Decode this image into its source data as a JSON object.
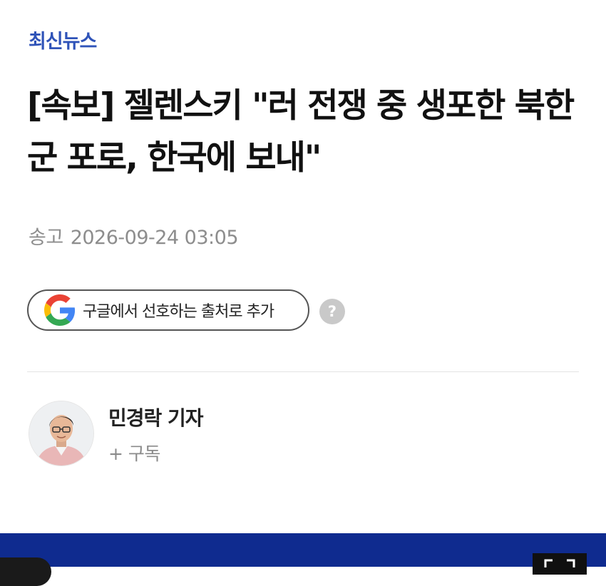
{
  "article": {
    "category": "최신뉴스",
    "headline": "[속보] 젤렌스키 \"러 전쟁 중 생포한 북한군 포로, 한국에 보내\"",
    "published_label": "송고",
    "published_datetime": "2026-09-24 03:05"
  },
  "google_button": {
    "label": "구글에서 선호하는 출처로 추가",
    "icon": "google-logo-icon"
  },
  "help": {
    "symbol": "?",
    "icon": "help-icon"
  },
  "author": {
    "name": "민경락 기자",
    "subscribe_label": "+ 구독",
    "avatar_icon": "reporter-avatar"
  },
  "colors": {
    "category": "#2f53b8",
    "bottom_bar": "#0f2b8f",
    "meta_text": "#8d8d8d",
    "google_blue": "#4285F4",
    "google_red": "#EA4335",
    "google_yellow": "#FBBC05",
    "google_green": "#34A853"
  }
}
